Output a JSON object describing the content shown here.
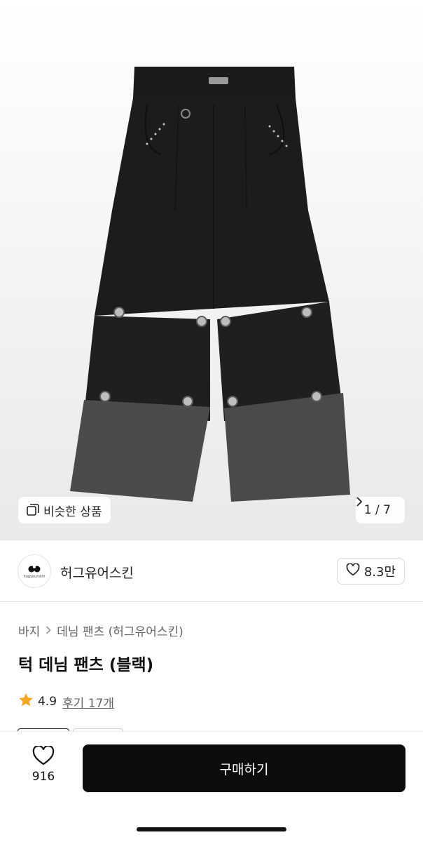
{
  "gallery": {
    "similar_label": "비슷한 상품",
    "current_page": "1",
    "separator": "/",
    "total_pages": "7"
  },
  "brand": {
    "name": "허그유어스킨",
    "logo_text": "hugyourskin",
    "likes": "8.3만"
  },
  "breadcrumb": {
    "category": "바지",
    "subcategory": "데님 팬츠 (허그유어스킨)"
  },
  "product": {
    "title": "턱 데님 팬츠 (블랙)",
    "rating": "4.9",
    "reviews": "후기 17개"
  },
  "bottom_bar": {
    "wish_count": "916",
    "buy_label": "구매하기"
  },
  "colors": {
    "star": "#f5a623",
    "buy_button": "#0d0d0d"
  }
}
